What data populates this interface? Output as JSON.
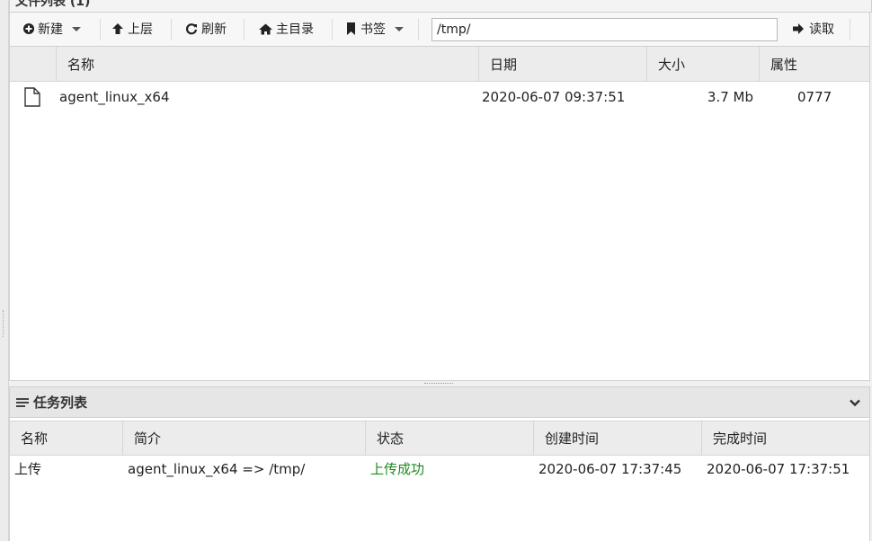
{
  "window": {
    "panel_title": "文件列表 (1)"
  },
  "toolbar": {
    "new_label": "新建",
    "up_label": "上层",
    "refresh_label": "刷新",
    "home_label": "主目录",
    "bookmark_label": "书签",
    "path_value": "/tmp/",
    "read_label": "读取"
  },
  "file_grid": {
    "columns": {
      "name": "名称",
      "date": "日期",
      "size": "大小",
      "attr": "属性"
    },
    "rows": [
      {
        "name": "agent_linux_x64",
        "date": "2020-06-07 09:37:51",
        "size": "3.7 Mb",
        "attr": "0777"
      }
    ]
  },
  "task_panel": {
    "title": "任务列表",
    "columns": {
      "name": "名称",
      "desc": "简介",
      "status": "状态",
      "created": "创建时间",
      "finished": "完成时间"
    },
    "rows": [
      {
        "name": "上传",
        "desc": "agent_linux_x64 => /tmp/",
        "status": "上传成功",
        "created": "2020-06-07 17:37:45",
        "finished": "2020-06-07 17:37:51"
      }
    ]
  },
  "colors": {
    "success": "#1f8a1f",
    "header_bg": "#ececec",
    "border": "#d0d0d0"
  }
}
